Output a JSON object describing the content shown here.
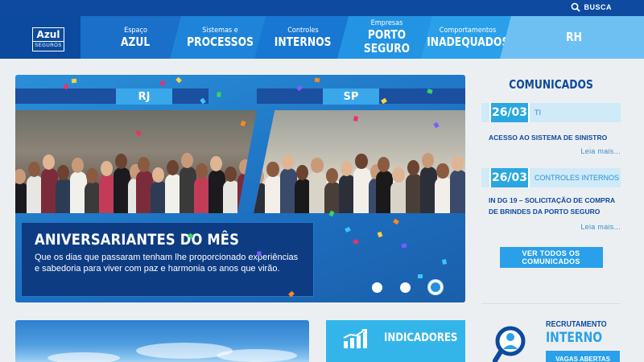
{
  "header": {
    "search_label": "BUSCA",
    "logo": {
      "main": "Azul",
      "sub": "SEGUROS"
    },
    "tabs": [
      {
        "small": "Espaço",
        "big": "AZUL"
      },
      {
        "small": "Sistemas e",
        "big": "PROCESSOS"
      },
      {
        "small": "Controles",
        "big": "INTERNOS"
      },
      {
        "small": "Empresas",
        "big": "PORTO SEGURO"
      },
      {
        "small": "Comportamentos",
        "big": "INADEQUADOS"
      },
      {
        "small": "",
        "big": "RH"
      }
    ]
  },
  "banner": {
    "label_left": "RJ",
    "label_right": "SP",
    "title": "ANIVERSARIANTES DO MÊS",
    "text": "Que os dias que passaram tenham lhe proporcionado experiências e sabedoria para viver com paz e harmonia os anos que virão.",
    "active_slide": 3,
    "slide_count": 3
  },
  "comunicados": {
    "title": "COMUNICADOS",
    "items": [
      {
        "date": "26/03",
        "category": "TI",
        "title": "ACESSO AO SISTEMA DE SINISTRO",
        "more": "Leia mais..."
      },
      {
        "date": "26/03",
        "category": "CONTROLES INTERNOS",
        "title": "IN DG 19 – SOLICITAÇÃO DE COMPRA DE BRINDES DA PORTO SEGURO",
        "more": "Leia mais..."
      }
    ],
    "button": "VER TODOS OS COMUNICADOS"
  },
  "indicadores": {
    "label": "INDICADORES"
  },
  "recrutamento": {
    "line1": "RECRUTAMENTO",
    "line2": "INTERNO",
    "button": "VAGAS ABERTAS"
  },
  "colors": {
    "primary": "#0b4a9e",
    "accent": "#2aa0ea",
    "light": "#cfeaf8"
  }
}
